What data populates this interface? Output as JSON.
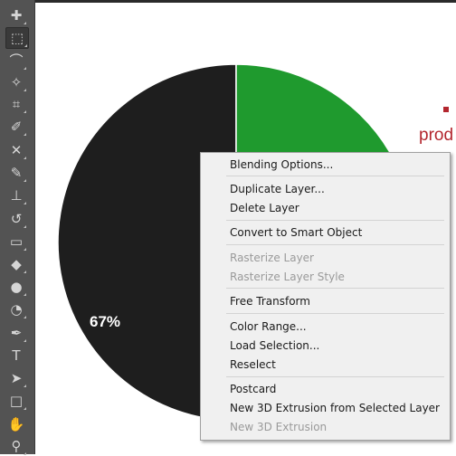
{
  "toolbar": {
    "tools": [
      {
        "icon": "move-tool-icon",
        "glyph": "✚",
        "active": false
      },
      {
        "icon": "rectangular-marquee-icon",
        "glyph": "⬚",
        "active": true
      },
      {
        "icon": "lasso-icon",
        "glyph": "⌒",
        "active": false
      },
      {
        "icon": "magic-wand-icon",
        "glyph": "✧",
        "active": false
      },
      {
        "icon": "crop-icon",
        "glyph": "⌗",
        "active": false
      },
      {
        "icon": "eyedropper-icon",
        "glyph": "✐",
        "active": false
      },
      {
        "icon": "spot-healing-icon",
        "glyph": "✕",
        "active": false
      },
      {
        "icon": "brush-icon",
        "glyph": "✎",
        "active": false
      },
      {
        "icon": "clone-stamp-icon",
        "glyph": "⊥",
        "active": false
      },
      {
        "icon": "history-brush-icon",
        "glyph": "↺",
        "active": false
      },
      {
        "icon": "eraser-icon",
        "glyph": "▭",
        "active": false
      },
      {
        "icon": "paint-bucket-icon",
        "glyph": "◆",
        "active": false
      },
      {
        "icon": "blur-icon",
        "glyph": "●",
        "active": false
      },
      {
        "icon": "dodge-icon",
        "glyph": "◔",
        "active": false
      },
      {
        "icon": "pen-icon",
        "glyph": "✒",
        "active": false
      },
      {
        "icon": "type-icon",
        "glyph": "T",
        "active": false
      },
      {
        "icon": "path-selection-icon",
        "glyph": "➤",
        "active": false
      },
      {
        "icon": "rectangle-shape-icon",
        "glyph": "□",
        "active": false
      },
      {
        "icon": "hand-icon",
        "glyph": "✋",
        "active": false
      },
      {
        "icon": "zoom-icon",
        "glyph": "⚲",
        "active": false
      }
    ]
  },
  "canvas": {
    "chart_data": {
      "type": "pie",
      "slices": [
        {
          "label": "",
          "value": 67,
          "color": "#1e1e1e"
        },
        {
          "label": "",
          "value": 33,
          "color": "#1f9a2e"
        }
      ],
      "data_labels": [
        "67%"
      ]
    },
    "slice_label": "67%",
    "legend_text": "prod",
    "legend_color": "#b3262e"
  },
  "context_menu": {
    "items": [
      {
        "label": "Blending Options...",
        "enabled": true
      },
      {
        "label": "Duplicate Layer...",
        "enabled": true
      },
      {
        "label": "Delete Layer",
        "enabled": true
      },
      {
        "label": "Convert to Smart Object",
        "enabled": true
      },
      {
        "label": "Rasterize Layer",
        "enabled": false
      },
      {
        "label": "Rasterize Layer Style",
        "enabled": false
      },
      {
        "label": "Free Transform",
        "enabled": true
      },
      {
        "label": "Color Range...",
        "enabled": true
      },
      {
        "label": "Load Selection...",
        "enabled": true
      },
      {
        "label": "Reselect",
        "enabled": true
      },
      {
        "label": "Postcard",
        "enabled": true
      },
      {
        "label": "New 3D Extrusion from Selected Layer",
        "enabled": true
      },
      {
        "label": "New 3D Extrusion",
        "enabled": false
      }
    ]
  }
}
